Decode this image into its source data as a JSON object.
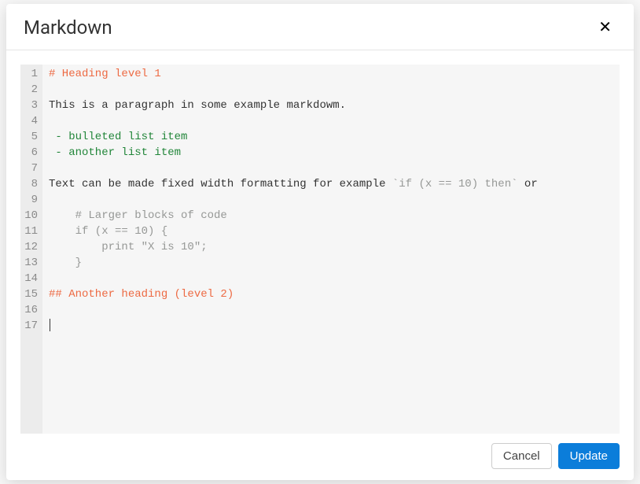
{
  "modal": {
    "title": "Markdown"
  },
  "editor": {
    "lines": [
      {
        "n": 1,
        "segments": [
          {
            "cls": "tok-heading",
            "text": "# Heading level 1"
          }
        ]
      },
      {
        "n": 2,
        "segments": []
      },
      {
        "n": 3,
        "segments": [
          {
            "cls": "",
            "text": "This is a paragraph in some example markdowm."
          }
        ]
      },
      {
        "n": 4,
        "segments": []
      },
      {
        "n": 5,
        "segments": [
          {
            "cls": "tok-list",
            "text": " - bulleted list item"
          }
        ]
      },
      {
        "n": 6,
        "segments": [
          {
            "cls": "tok-list",
            "text": " - another list item"
          }
        ]
      },
      {
        "n": 7,
        "segments": []
      },
      {
        "n": 8,
        "segments": [
          {
            "cls": "",
            "text": "Text can be made fixed width formatting for example "
          },
          {
            "cls": "tok-code",
            "text": "`if (x == 10) then`"
          },
          {
            "cls": "",
            "text": " or"
          }
        ]
      },
      {
        "n": 9,
        "segments": []
      },
      {
        "n": 10,
        "segments": [
          {
            "cls": "tok-code",
            "text": "    # Larger blocks of code"
          }
        ]
      },
      {
        "n": 11,
        "segments": [
          {
            "cls": "tok-code",
            "text": "    if (x == 10) {"
          }
        ]
      },
      {
        "n": 12,
        "segments": [
          {
            "cls": "tok-code",
            "text": "        print \"X is 10\";"
          }
        ]
      },
      {
        "n": 13,
        "segments": [
          {
            "cls": "tok-code",
            "text": "    }"
          }
        ]
      },
      {
        "n": 14,
        "segments": []
      },
      {
        "n": 15,
        "segments": [
          {
            "cls": "tok-heading",
            "text": "## Another heading (level 2)"
          }
        ]
      },
      {
        "n": 16,
        "segments": []
      },
      {
        "n": 17,
        "segments": [],
        "cursor": true
      }
    ]
  },
  "buttons": {
    "cancel": "Cancel",
    "update": "Update"
  }
}
